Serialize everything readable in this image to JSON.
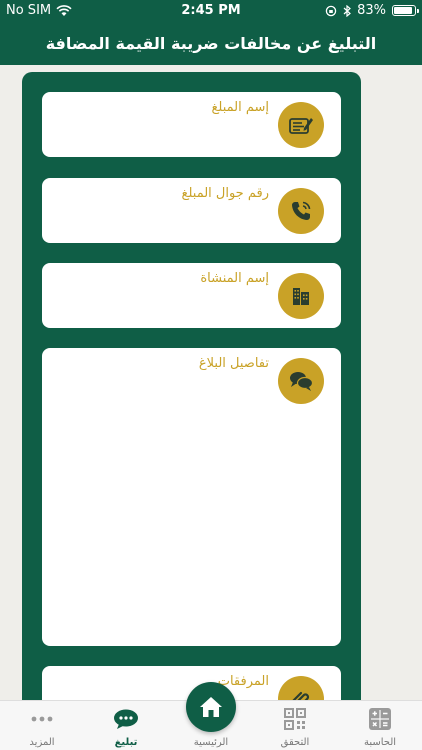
{
  "status_bar": {
    "carrier": "No SIM",
    "time": "2:45 PM",
    "battery_percent": "83%",
    "battery_level": 0.83
  },
  "header": {
    "title": "التبليغ عن مخالفات ضريبة القيمة المضافة"
  },
  "form": {
    "fields": [
      {
        "label": "إسم المبلغ",
        "icon": "form-edit-icon"
      },
      {
        "label": "رقم جوال المبلغ",
        "icon": "phone-icon"
      },
      {
        "label": "إسم المنشاة",
        "icon": "building-icon"
      },
      {
        "label": "تفاصيل البلاغ",
        "icon": "chat-bubbles-icon"
      },
      {
        "label": "المرفقات",
        "icon": "paperclip-icon"
      }
    ]
  },
  "tabbar": {
    "tabs": [
      {
        "label": "المزيد",
        "icon": "more-dots-icon"
      },
      {
        "label": "تبليغ",
        "icon": "chat-report-icon",
        "active": true
      },
      {
        "label": "الرئيسية",
        "icon": "home-icon"
      },
      {
        "label": "التحقق",
        "icon": "qr-code-icon"
      },
      {
        "label": "الحاسبة",
        "icon": "calculator-icon"
      }
    ]
  },
  "colors": {
    "primary": "#0f5e46",
    "accent": "#c9a227",
    "background": "#efeeea"
  }
}
